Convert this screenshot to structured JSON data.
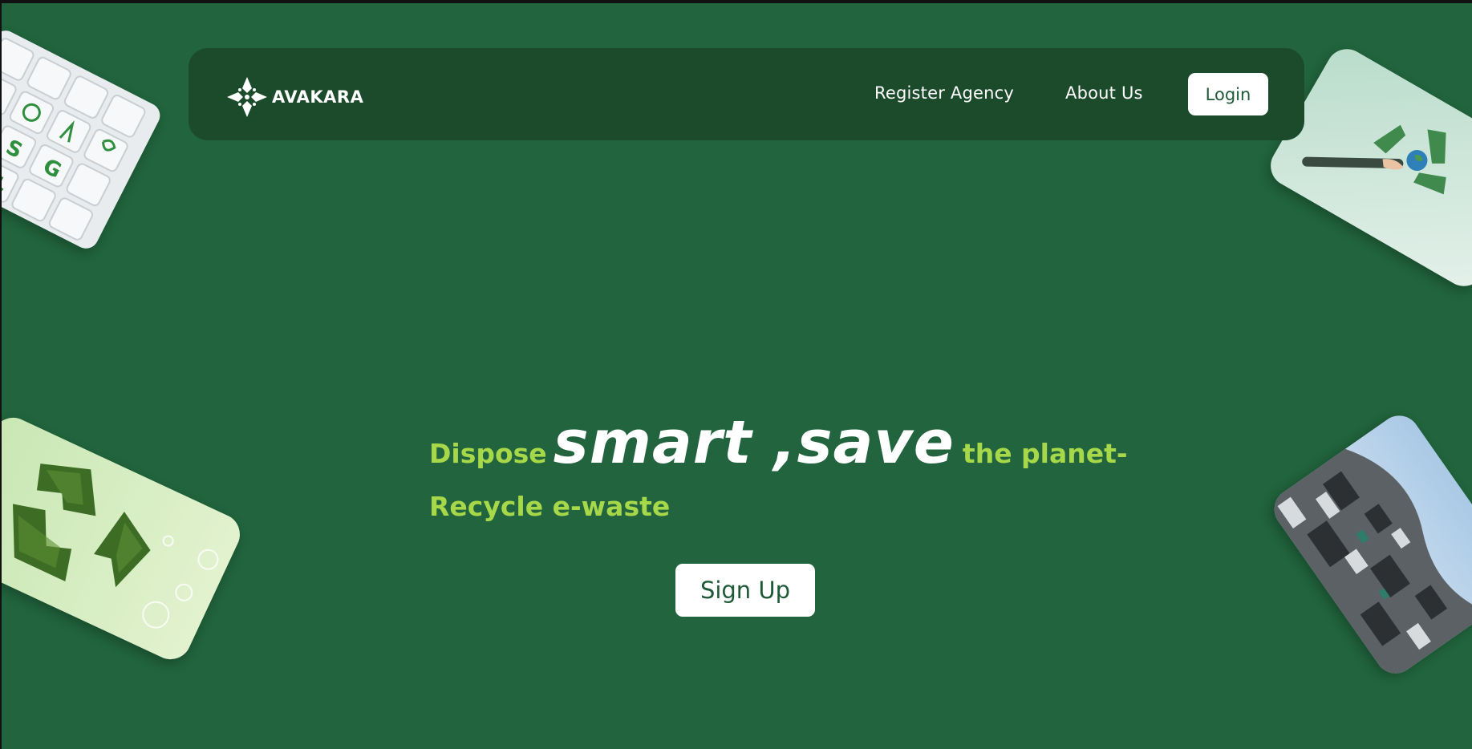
{
  "brand": {
    "name": "AVAKARA",
    "logo_icon": "diamond-flower-icon"
  },
  "nav": {
    "register_agency": "Register Agency",
    "about_us": "About Us",
    "login": "Login"
  },
  "hero": {
    "prefix": "Dispose",
    "emphasis": "smart ,save",
    "suffix": "the planet-",
    "line2": "Recycle e-waste",
    "signup": "Sign Up"
  },
  "decor": {
    "top_left": "esg-keyboard-image",
    "top_right": "recycle-hand-image",
    "bottom_left": "grass-recycle-image",
    "bottom_right": "ewaste-pile-image"
  },
  "colors": {
    "page_bg": "#21643d",
    "navbar_bg": "#1c4b2c",
    "accent": "#a6d84a",
    "button_text": "#1f5a37"
  }
}
